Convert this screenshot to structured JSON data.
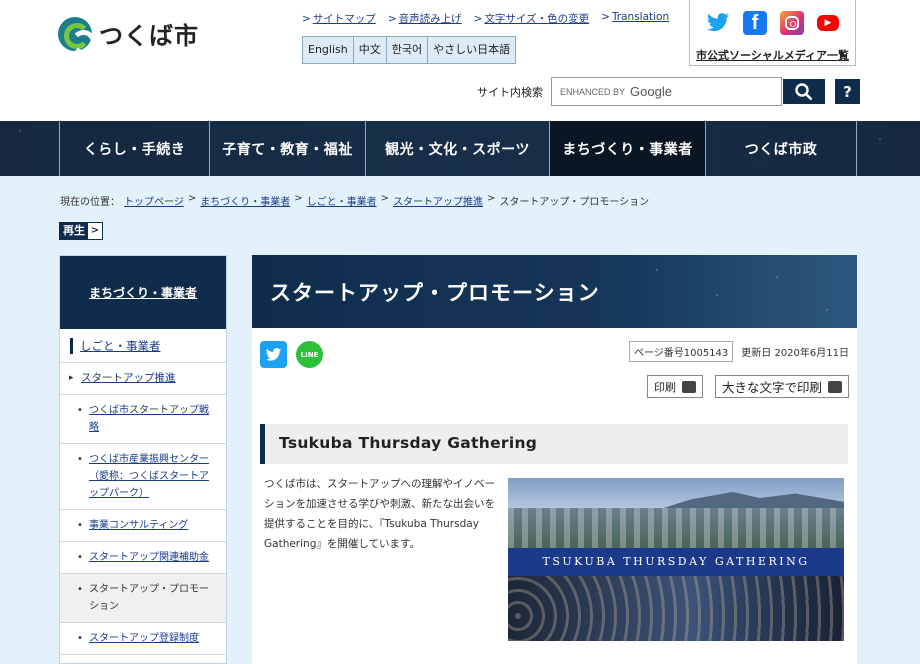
{
  "header": {
    "logo_text": "つくば市",
    "utility_links": [
      "サイトマップ",
      "音声読み上げ",
      "文字サイズ・色の変更",
      "Translation"
    ],
    "languages": [
      "English",
      "中文",
      "한국어",
      "やさしい日本語"
    ],
    "social_label": "市公式ソーシャルメディア一覧",
    "social_icons": [
      "twitter-icon",
      "facebook-icon",
      "instagram-icon",
      "youtube-icon"
    ],
    "search": {
      "label": "サイト内検索",
      "placeholder_prefix": "ENHANCED BY",
      "placeholder_brand": "Google",
      "help_label": "?"
    }
  },
  "nav": {
    "items": [
      {
        "label": "くらし・手続き"
      },
      {
        "label": "子育て・教育・福祉"
      },
      {
        "label": "観光・文化・スポーツ"
      },
      {
        "label": "まちづくり・事業者"
      },
      {
        "label": "つくば市政"
      }
    ]
  },
  "breadcrumb": {
    "label": "現在の位置：",
    "items": [
      "トップページ",
      "まちづくり・事業者",
      "しごと・事業者",
      "スタートアップ推進",
      "スタートアップ・プロモーション"
    ],
    "separator": ">"
  },
  "play_button": {
    "label": "再生",
    "arrow": ">"
  },
  "sidebar": {
    "heading": "まちづくり・事業者",
    "section": "しごと・事業者",
    "item": "スタートアップ推進",
    "subitems": [
      "つくば市スタートアップ戦略",
      "つくば市産業振興センター（愛称：つくばスタートアップパーク）",
      "事業コンサルティング",
      "スタートアップ関連補助金",
      "スタートアップ・プロモーション",
      "スタートアップ登録制度"
    ]
  },
  "main": {
    "title": "スタートアップ・プロモーション",
    "page_number": "ページ番号1005143",
    "updated": "更新日 2020年6月11日",
    "print_label": "印刷",
    "print_large_label": "大きな文字で印刷",
    "share": {
      "twitter": "twitter-share",
      "line_label": "LINE"
    },
    "section_heading": "Tsukuba Thursday Gathering",
    "paragraph": "つくば市は、スタートアップへの理解やイノベーションを加速させる学びや刺激、新たな出会いを提供することを目的に、『Tsukuba Thursday Gathering』を開催しています。",
    "photo_caption": "TSUKUBA THURSDAY GATHERING"
  },
  "colors": {
    "navy": "#0f2c4c",
    "link": "#1a3c8c",
    "content_bg": "#e3f1fb",
    "twitter": "#1da1f2",
    "line": "#2bc13b"
  }
}
